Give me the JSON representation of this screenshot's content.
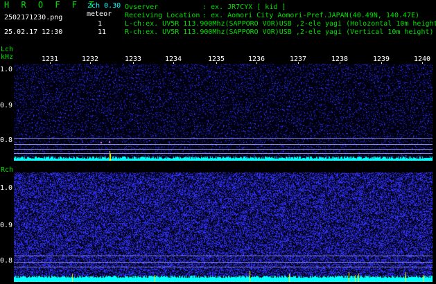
{
  "header": {
    "app_title": "H R O F F T",
    "mode": "2ch 0.30",
    "filename": "2502171230.png",
    "category": "meteor",
    "count_l": "1",
    "count_r": "11",
    "datetime": "25.02.17 12:30",
    "observer_label": "Ovserver",
    "observer_value": ":  ex. JR7CYX [ kid ]",
    "location_label": "Receiving Location",
    "location_value": ":  ex. Aomori City Aomori-Pref.JAPAN(40.49N, 140.47E)",
    "lch_info": "L-ch:ex. UV5R 113.900Mhz(SAPPORO VOR)USB ,2-ele yagi (Holozontal 10m height",
    "rch_info": "R-ch:ex. UV5R 113.900Mhz(SAPPORO VOR)USB ,2-ele yagi (Vertical 10m height)"
  },
  "axis": {
    "lch_label": "Lch",
    "unit_label": "kHz",
    "rch_label": "Rch",
    "x_ticks": [
      "1231",
      "1232",
      "1233",
      "1234",
      "1235",
      "1236",
      "1237",
      "1238",
      "1239",
      "1240"
    ],
    "lch_y_ticks": [
      "1.0",
      "0.9",
      "0.8"
    ],
    "rch_y_ticks": [
      "1.0",
      "0.9",
      "0.8"
    ]
  },
  "colors": {
    "label_green": "#00e000",
    "label_cyan": "#00ffff",
    "noise_blue": "#3030ff",
    "baseline_cyan": "#00ffff",
    "meteor_yellow": "#ffff00"
  }
}
